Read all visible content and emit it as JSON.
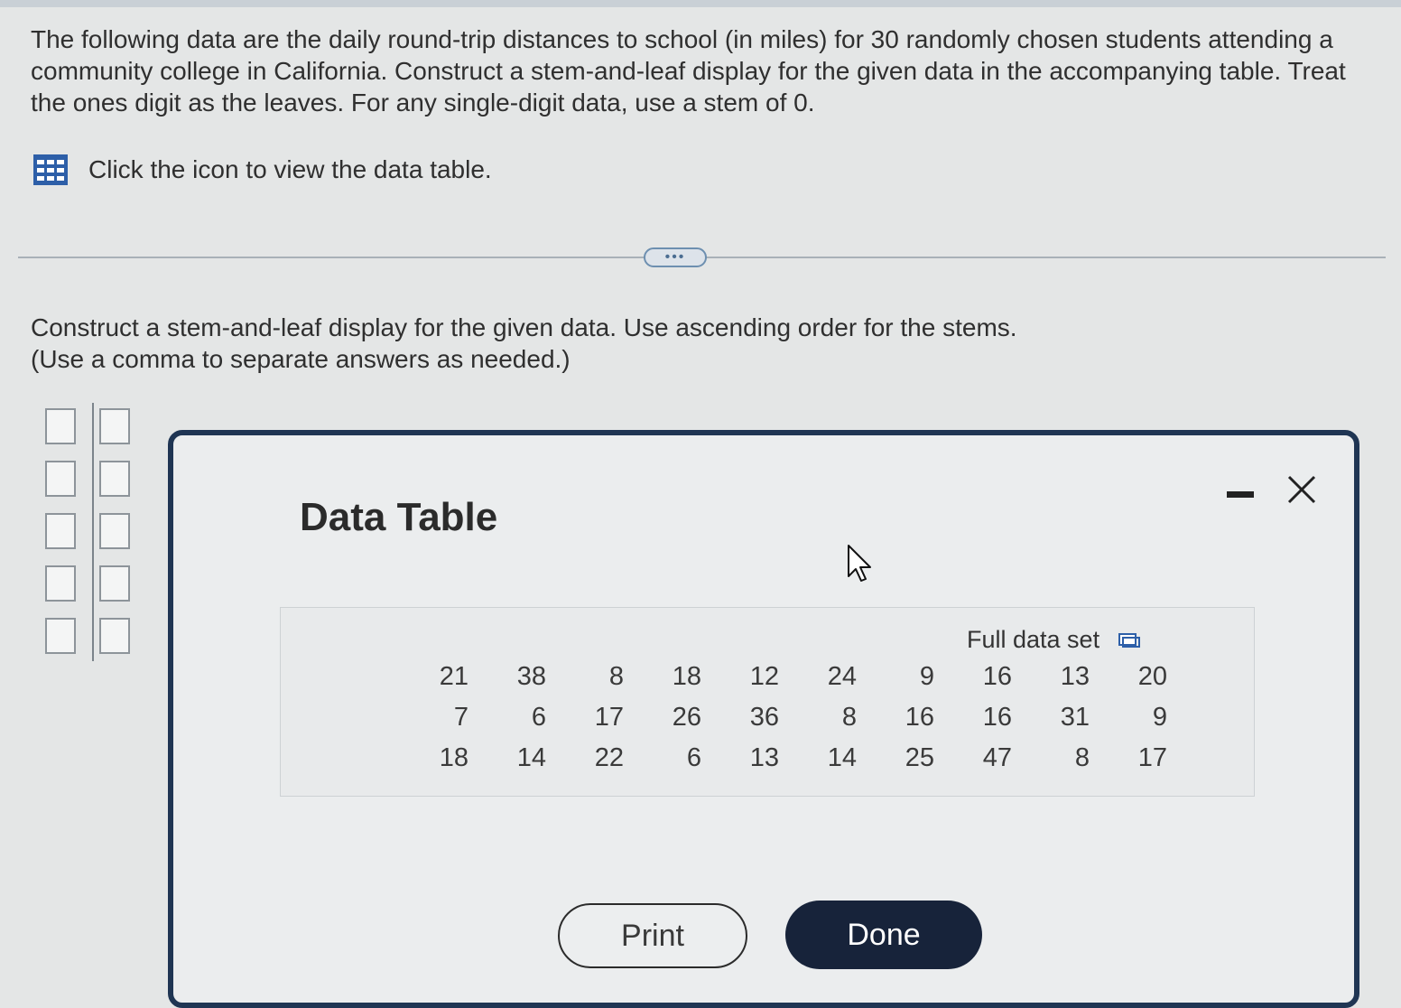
{
  "question": {
    "text": "The following data are the daily round-trip distances to school (in miles) for 30 randomly chosen students attending a community college in California. Construct a stem-and-leaf display for the given data in the accompanying table. Treat the ones digit as the leaves. For any single-digit data, use a stem of 0."
  },
  "data_link": {
    "icon": "table-grid-icon",
    "label": "Click the icon to view the data table."
  },
  "more_button": {
    "label": "•••"
  },
  "part": {
    "instruction": "Construct a stem-and-leaf display for the given data. Use ascending order for the stems.",
    "hint": "(Use a comma to separate answers as needed.)"
  },
  "answer_grid": {
    "rows": [
      {
        "stem": "",
        "leaves": ""
      },
      {
        "stem": "",
        "leaves": ""
      },
      {
        "stem": "",
        "leaves": ""
      },
      {
        "stem": "",
        "leaves": ""
      },
      {
        "stem": "",
        "leaves": ""
      }
    ]
  },
  "modal": {
    "title": "Data Table",
    "minimize_icon": "minimize-icon",
    "close_icon": "close-icon",
    "full_data_set_label": "Full data set",
    "copy_icon": "copy-icon",
    "rows": [
      [
        "21",
        "38",
        "8",
        "18",
        "12",
        "24",
        "9",
        "16",
        "13",
        "20"
      ],
      [
        "7",
        "6",
        "17",
        "26",
        "36",
        "8",
        "16",
        "16",
        "31",
        "9"
      ],
      [
        "18",
        "14",
        "22",
        "6",
        "13",
        "14",
        "25",
        "47",
        "8",
        "17"
      ]
    ],
    "print_label": "Print",
    "done_label": "Done"
  },
  "colors": {
    "background": "#e4e6e6",
    "modal_border": "#1f3553",
    "done_button": "#17233a",
    "icon_blue": "#2d5fa8"
  }
}
